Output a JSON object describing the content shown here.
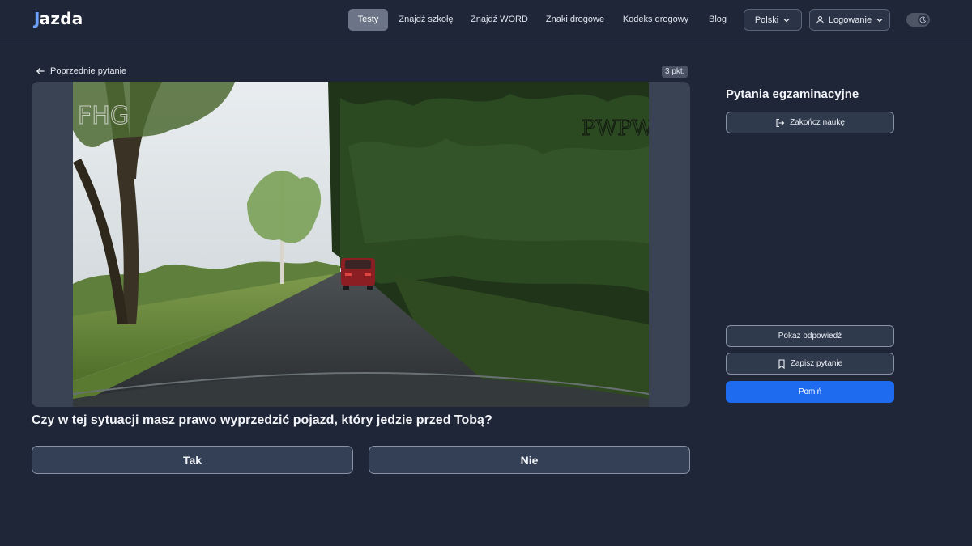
{
  "logo": {
    "j": "J",
    "rest": "azda"
  },
  "nav": {
    "items": [
      {
        "label": "Testy",
        "active": true
      },
      {
        "label": "Znajdź szkołę",
        "active": false
      },
      {
        "label": "Znajdź WORD",
        "active": false
      },
      {
        "label": "Znaki drogowe",
        "active": false
      },
      {
        "label": "Kodeks drogowy",
        "active": false
      },
      {
        "label": "Blog",
        "active": false
      }
    ],
    "language": "Polski",
    "login": "Logowanie",
    "theme_icon": "moon-icon"
  },
  "question": {
    "back_label": "Poprzednie pytanie",
    "points": "3 pkt.",
    "image_watermark_left": "FHG",
    "image_watermark_right": "PWPW",
    "text": "Czy w tej sytuacji masz prawo wyprzedzić pojazd, który jedzie przed Tobą?",
    "answers": [
      "Tak",
      "Nie"
    ]
  },
  "sidebar": {
    "title": "Pytania egzaminacyjne",
    "end_label": "Zakończ naukę",
    "show_answer_label": "Pokaż odpowiedź",
    "save_label": "Zapisz pytanie",
    "skip_label": "Pomiń",
    "primary_color": "#1e6bf0"
  }
}
